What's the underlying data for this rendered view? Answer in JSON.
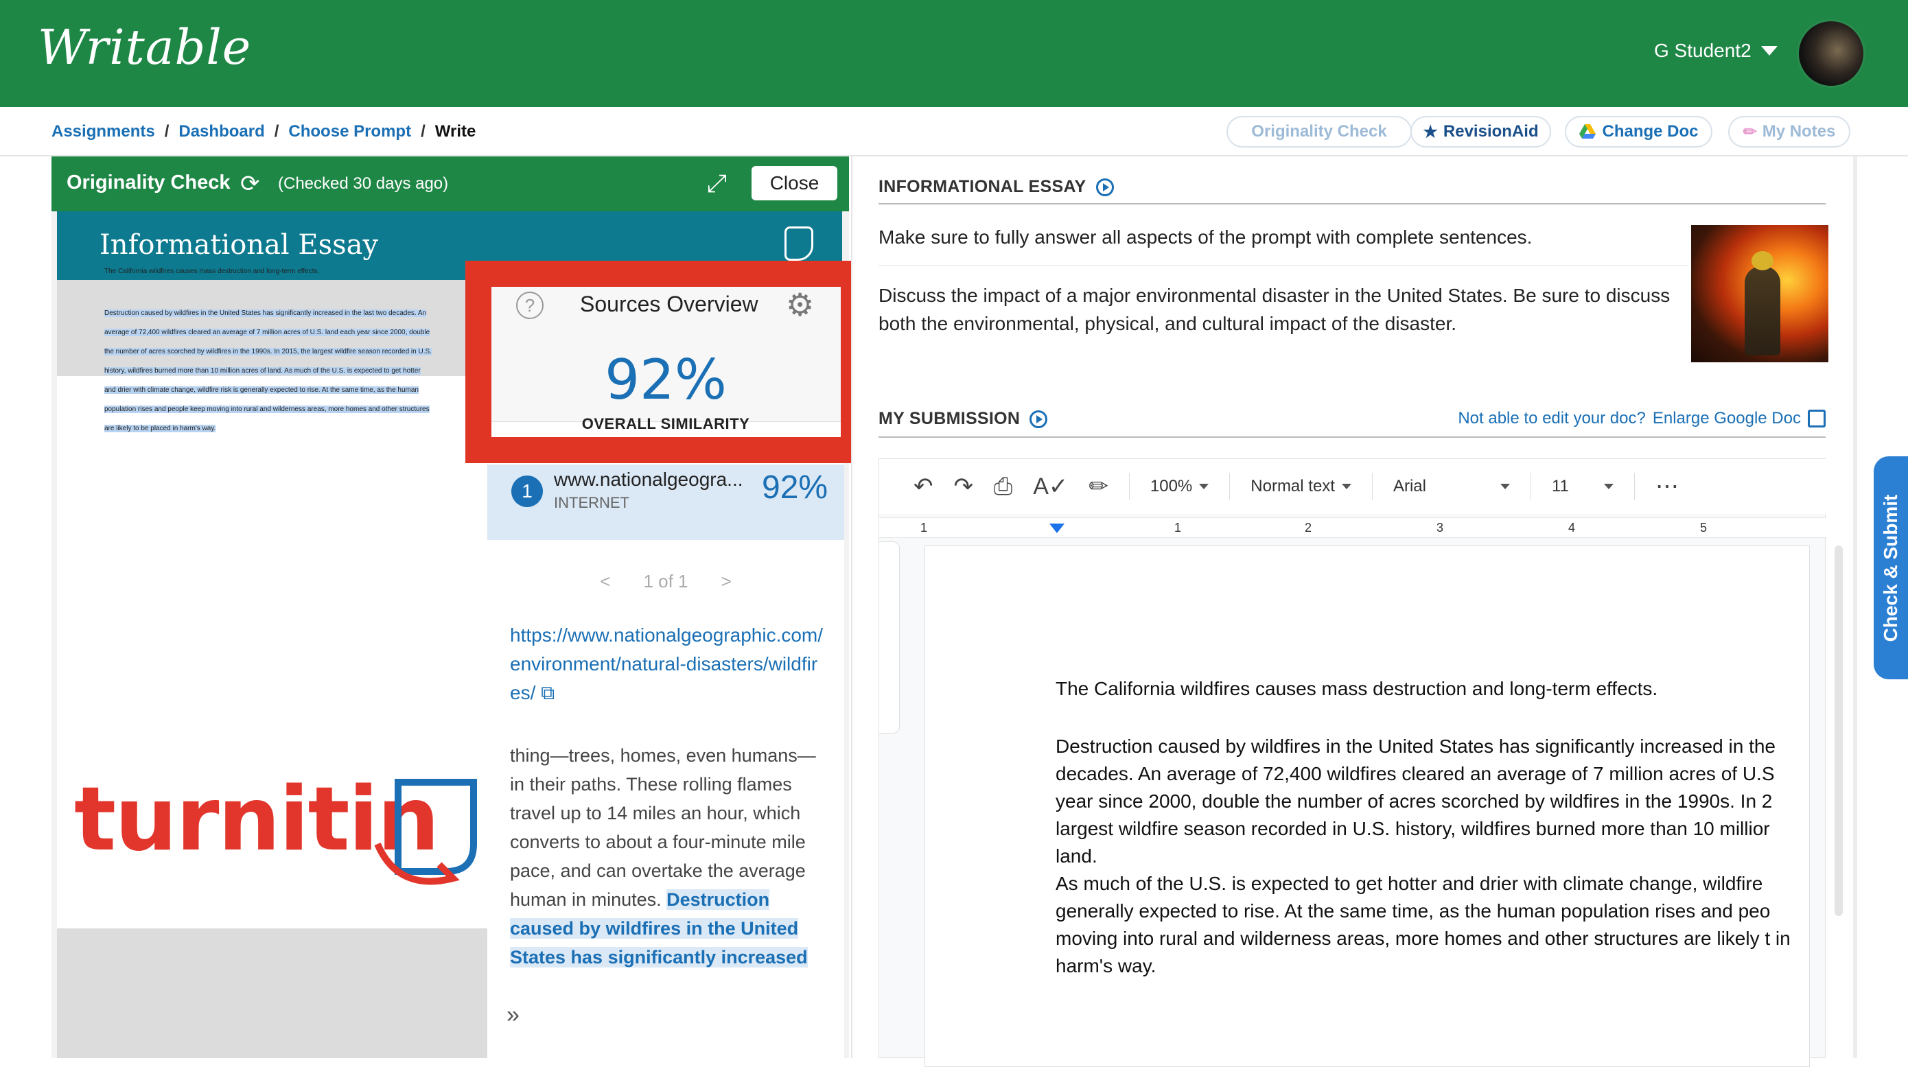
{
  "header": {
    "logo": "Writable",
    "user_name": "G Student2"
  },
  "breadcrumb": {
    "items": [
      "Assignments",
      "Dashboard",
      "Choose Prompt"
    ],
    "current": "Write",
    "separator": "/"
  },
  "toolbar": {
    "originality_check": "Originality Check",
    "revision_aid": "RevisionAid",
    "change_doc": "Change Doc",
    "my_notes": "My Notes"
  },
  "originality_panel": {
    "title": "Originality Check",
    "checked": "(Checked 30 days ago)",
    "close": "Close",
    "essay_title": "Informational Essay",
    "mini_doc_title": "The California wildfires causes mass destruction and long-term effects.",
    "mini_doc_body": "Destruction caused by wildfires in the United States has significantly increased in the last two decades. An average of 72,400 wildfires cleared an average of 7 million acres of U.S. land each year since 2000, double the number of acres scorched by wildfires in the 1990s. In 2015, the largest wildfire season recorded in U.S. history, wildfires burned more than 10 million acres of land. As much of the U.S. is expected to get hotter and drier with climate change, wildfire risk is generally expected to rise. At the same time, as the human population rises and people keep moving into rural and wilderness areas, more homes and other structures are likely to be placed in harm's way.",
    "turnitin_logo": "turnitin"
  },
  "sources_overview": {
    "title": "Sources Overview",
    "help": "?",
    "overall_pct": "92%",
    "overall_label": "OVERALL SIMILARITY",
    "match": {
      "number": "1",
      "url": "www.nationalgeogra...",
      "type": "INTERNET",
      "pct": "92%"
    },
    "pager": {
      "prev": "<",
      "label": "1 of 1",
      "next": ">"
    },
    "source_link": "https://www.nationalgeographic.com/environment/natural-disasters/wildfires/",
    "source_text_plain": "thing—trees, homes, even humans—in their paths. These rolling flames travel up to 14 miles an hour, which converts to about a four-minute mile pace, and can overtake the average human in minutes. ",
    "source_text_highlight": "Destruction caused by wildfires in the United States has significantly increased in the last two decades. An average of",
    "collapse": "»"
  },
  "prompt": {
    "section_title": "INFORMATIONAL ESSAY",
    "instruction_1": "Make sure to fully answer all aspects of the prompt with complete sentences.",
    "instruction_2": "Discuss the impact of a major environmental disaster in the United States. Be sure to discuss both the environmental, physical, and cultural impact of the disaster."
  },
  "submission": {
    "section_title": "MY SUBMISSION",
    "not_able": "Not able to edit your doc?",
    "enlarge": "Enlarge Google Doc"
  },
  "gdoc_toolbar": {
    "zoom": "100%",
    "style": "Normal text",
    "font": "Arial",
    "size": "11",
    "more": "⋯"
  },
  "ruler": [
    "1",
    "1",
    "2",
    "3",
    "4",
    "5"
  ],
  "document": {
    "title_line": "The California wildfires causes mass destruction and long-term effects.",
    "para1": "Destruction caused by wildfires in the United States has significantly increased in the decades. An average of 72,400 wildfires cleared an average of 7 million acres of U.S year since 2000, double the number of acres scorched by wildfires in the 1990s. In 2 largest wildfire season recorded in U.S. history, wildfires burned more than 10 millior land.",
    "para2": "As much of the U.S. is expected to get hotter and drier with climate change, wildfire generally expected to rise. At the same time, as the human population rises and peo moving into rural and wilderness areas, more homes and other structures are likely t in harm's way."
  },
  "side_tab": "Check & Submit",
  "colors": {
    "brand_green": "#1f8746",
    "teal": "#0d7a8f",
    "link_blue": "#1a6fb5",
    "highlight_red": "#e03524"
  }
}
